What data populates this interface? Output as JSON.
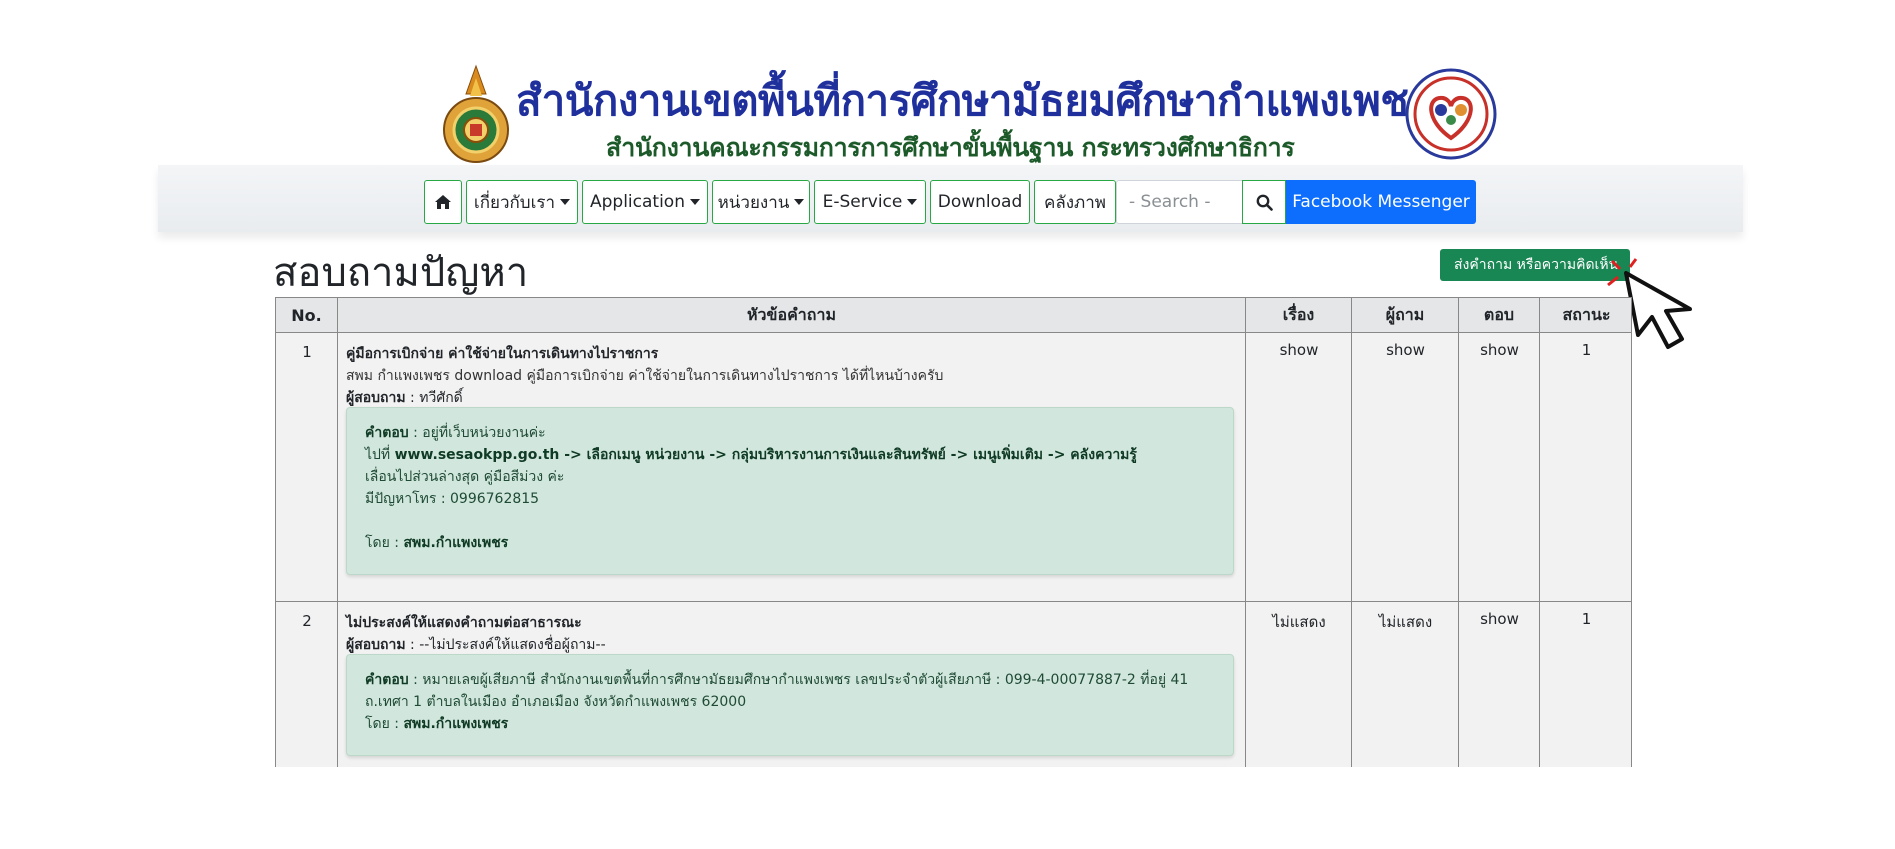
{
  "header": {
    "title_main": "สำนักงานเขตพื้นที่การศึกษามัธยมศึกษากำแพงเพชร",
    "title_sub": "สำนักงานคณะกรรมการการศึกษาขั้นพื้นฐาน กระทรวงศึกษาธิการ"
  },
  "nav": {
    "items": [
      {
        "label": "เกี่ยวกับเรา",
        "dropdown": true
      },
      {
        "label": "Application",
        "dropdown": true
      },
      {
        "label": "หน่วยงาน",
        "dropdown": true
      },
      {
        "label": "E-Service",
        "dropdown": true
      },
      {
        "label": "Download",
        "dropdown": false
      },
      {
        "label": "คลังภาพ",
        "dropdown": false
      }
    ],
    "search_placeholder": "- Search -",
    "messenger_label": "Facebook Messenger",
    "icons": {
      "home": "home-icon",
      "search": "search-icon"
    }
  },
  "page": {
    "title": "สอบถามปัญหา",
    "submit_label": "ส่งคำถาม หรือความคิดเห็น"
  },
  "table": {
    "headers": [
      "No.",
      "หัวข้อคำถาม",
      "เรื่อง",
      "ผู้ถาม",
      "ตอบ",
      "สถานะ"
    ],
    "rows": [
      {
        "no": "1",
        "title": "คู่มือการเบิกจ่าย ค่าใช้จ่ายในการเดินทางไปราชการ",
        "body": "สพม กำแพงเพชร download คู่มือการเบิกจ่าย ค่าใช้จ่ายในการเดินทางไปราชการ ได้ที่ไหนบ้างครับ",
        "asker_label": "ผู้สอบถาม",
        "asker": " : ทวีศักดิ์",
        "answer_label": "คำตอบ",
        "answer_line1": " : อยู่ที่เว็บหน่วยงานค่ะ",
        "answer_line2_prefix": "ไปที่ ",
        "answer_line2_bold": "www.sesaokpp.go.th -> เลือกเมนู หน่วยงาน -> กลุ่มบริหารงานการเงินและสินทรัพย์ -> เมนูเพิ่มเติม -> คลังความรู้",
        "answer_line3": "เลื่อนไปส่วนล่างสุด คู่มือสีม่วง ค่ะ",
        "answer_line4": "มีปัญหาโทร : 0996762815",
        "by_label": "โดย : ",
        "by": "สพม.กำแพงเพชร",
        "topic": "show",
        "asker_col": "show",
        "reply": "show",
        "status": "1"
      },
      {
        "no": "2",
        "title": "ไม่ประสงค์ให้แสดงคำถามต่อสาธารณะ",
        "asker_label": "ผู้สอบถาม",
        "asker": " : --ไม่ประสงค์ให้แสดงชื่อผู้ถาม--",
        "answer_label": "คำตอบ",
        "answer_line1": " : หมายเลขผู้เสียภาษี สำนักงานเขตพื้นที่การศึกษามัธยมศึกษากำแพงเพชร เลขประจำตัวผู้เสียภาษี : 099-4-00077887-2 ที่อยู่ 41",
        "answer_line2": "ถ.เทศา 1 ตำบลในเมือง อำเภอเมือง จังหวัดกำแพงเพชร 62000",
        "by_label": "โดย : ",
        "by": "สพม.กำแพงเพชร",
        "topic": "ไม่แสดง",
        "asker_col": "ไม่แสดง",
        "reply": "show",
        "status": "1"
      }
    ]
  },
  "colors": {
    "title_blue": "#1f2f9c",
    "subtitle_green": "#1d5a2a",
    "nav_border": "#28a745",
    "messenger_blue": "#0d6efd",
    "submit_green": "#198754",
    "answer_bg": "#d1e7dd"
  }
}
